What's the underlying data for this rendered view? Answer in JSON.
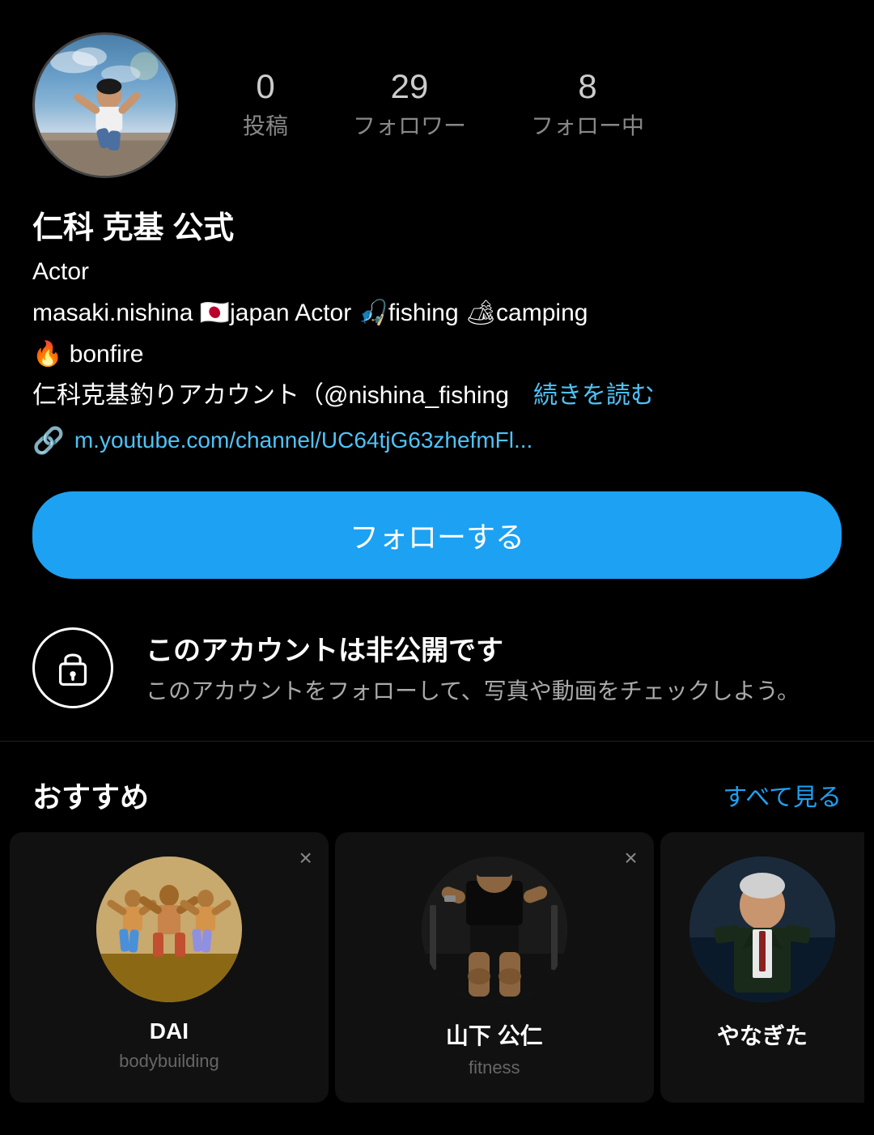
{
  "profile": {
    "avatar_alt": "Profile photo of Masaki Nishina sitting outdoors",
    "stats": {
      "posts_count": "0",
      "posts_label": "投稿",
      "followers_count": "29",
      "followers_label": "フォロワー",
      "following_count": "8",
      "following_label": "フォロー中"
    },
    "display_name": "仁科 克基 公式",
    "bio_line1": "Actor",
    "bio_line2": "masaki.nishina 🇯🇵japan  Actor  🎣fishing  🏕camping",
    "bio_line3": "🔥 bonfire",
    "bio_line4": "仁科克基釣りアカウント（@nishina_fishing　続きを読む",
    "link_url": "m.youtube.com/channel/UC64tjG63zhefmFl...",
    "follow_button_label": "フォローする",
    "private_title": "このアカウントは非公開です",
    "private_desc": "このアカウントをフォローして、写真や動画をチェックしよう。",
    "suggestions_title": "おすすめ",
    "see_all_label": "すべて見る",
    "suggestions": [
      {
        "name": "DAI",
        "sub": "bodybuilding",
        "avatar_type": "dai"
      },
      {
        "name": "山下 公仁",
        "sub": "fitness",
        "avatar_type": "yama"
      },
      {
        "name": "やなぎた",
        "sub": "",
        "avatar_type": "yanagi"
      }
    ]
  },
  "icons": {
    "link": "🔗",
    "lock": "lock",
    "close": "×"
  }
}
